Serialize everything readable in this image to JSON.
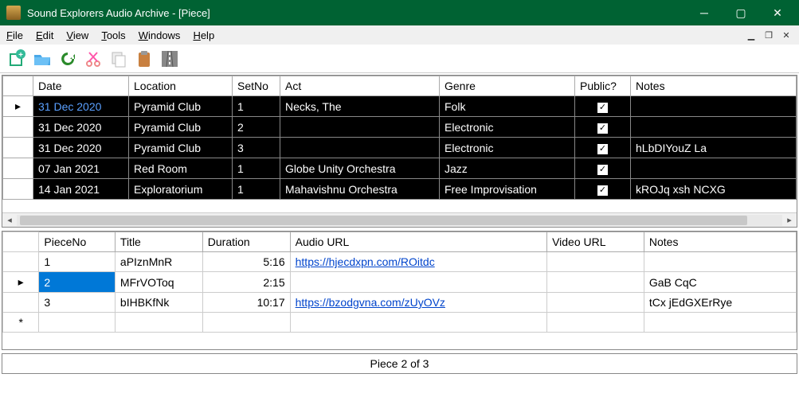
{
  "window": {
    "title": "Sound Explorers Audio Archive - [Piece]"
  },
  "menu": {
    "file": "File",
    "edit": "Edit",
    "view": "View",
    "tools": "Tools",
    "windows": "Windows",
    "help": "Help"
  },
  "toptable": {
    "headers": {
      "date": "Date",
      "location": "Location",
      "setno": "SetNo",
      "act": "Act",
      "genre": "Genre",
      "public": "Public?",
      "notes": "Notes"
    },
    "rows": [
      {
        "date": "31 Dec 2020",
        "location": "Pyramid Club",
        "setno": "1",
        "act": "Necks, The",
        "genre": "Folk",
        "public": true,
        "notes": "",
        "marker": "▸",
        "link": true
      },
      {
        "date": "31 Dec 2020",
        "location": "Pyramid Club",
        "setno": "2",
        "act": "",
        "genre": "Electronic",
        "public": true,
        "notes": "",
        "marker": ""
      },
      {
        "date": "31 Dec 2020",
        "location": "Pyramid Club",
        "setno": "3",
        "act": "",
        "genre": "Electronic",
        "public": true,
        "notes": "hLbDIYouZ La",
        "marker": ""
      },
      {
        "date": "07 Jan 2021",
        "location": "Red Room",
        "setno": "1",
        "act": "Globe Unity Orchestra",
        "genre": "Jazz",
        "public": true,
        "notes": "",
        "marker": ""
      },
      {
        "date": "14 Jan 2021",
        "location": "Exploratorium",
        "setno": "1",
        "act": "Mahavishnu Orchestra",
        "genre": "Free Improvisation",
        "public": true,
        "notes": "kROJq xsh NCXG",
        "marker": ""
      }
    ]
  },
  "bottomtable": {
    "headers": {
      "pieceno": "PieceNo",
      "title": "Title",
      "duration": "Duration",
      "audiourl": "Audio URL",
      "videourl": "Video URL",
      "notes": "Notes"
    },
    "rows": [
      {
        "pieceno": "1",
        "title": "aPIznMnR",
        "duration": "5:16",
        "audiourl": "https://hjecdxpn.com/ROitdc",
        "videourl": "",
        "notes": "",
        "marker": ""
      },
      {
        "pieceno": "2",
        "title": "MFrVOToq",
        "duration": "2:15",
        "audiourl": "",
        "videourl": "",
        "notes": "GaB CqC",
        "marker": "▸",
        "selected": true
      },
      {
        "pieceno": "3",
        "title": "bIHBKfNk",
        "duration": "10:17",
        "audiourl": "https://bzodgvna.com/zUyOVz",
        "videourl": "",
        "notes": "tCx jEdGXErRye",
        "marker": ""
      }
    ],
    "newrow_marker": "*"
  },
  "status": {
    "text": "Piece 2 of 3"
  }
}
